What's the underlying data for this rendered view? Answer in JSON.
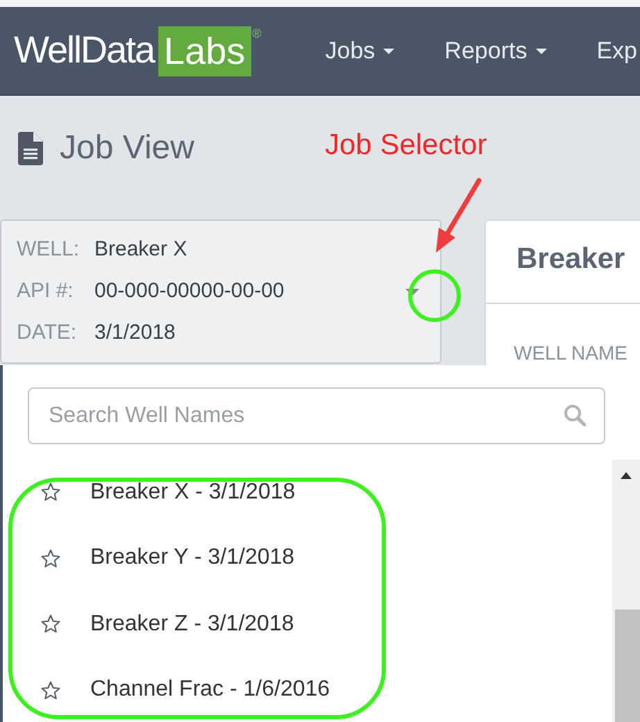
{
  "logo": {
    "text": "WellData",
    "badge": "Labs",
    "mark": "®"
  },
  "nav": [
    {
      "label": "Jobs",
      "dropdown": true
    },
    {
      "label": "Reports",
      "dropdown": true
    },
    {
      "label": "Exp",
      "dropdown": false
    }
  ],
  "page_title": "Job View",
  "annotation": {
    "label": "Job Selector"
  },
  "job_selector": {
    "fields": [
      {
        "label": "WELL:",
        "value": "Breaker X"
      },
      {
        "label": "API #:",
        "value": "00-000-00000-00-00"
      },
      {
        "label": "DATE:",
        "value": "3/1/2018"
      }
    ],
    "expanded": true
  },
  "detail_panel": {
    "title": "Breaker",
    "field_label": "WELL NAME"
  },
  "search": {
    "placeholder": "Search Well Names"
  },
  "wells": [
    {
      "name": "Breaker X - 3/1/2018",
      "starred": false
    },
    {
      "name": "Breaker Y - 3/1/2018",
      "starred": false
    },
    {
      "name": "Breaker Z - 3/1/2018",
      "starred": false
    },
    {
      "name": "Channel Frac - 1/6/2016",
      "starred": false
    }
  ]
}
